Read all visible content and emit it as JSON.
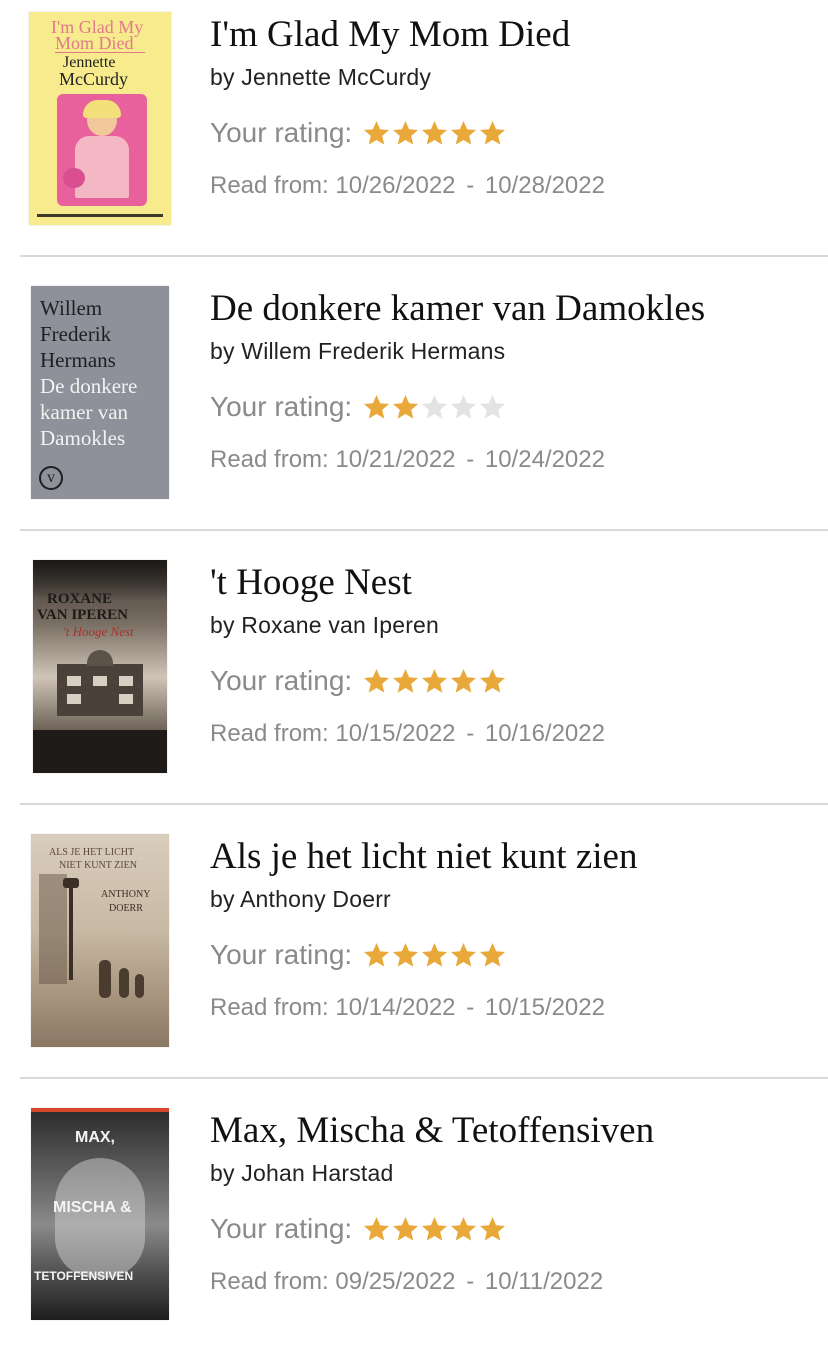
{
  "labels": {
    "rating_prefix": "Your rating:",
    "read_prefix": "Read from:",
    "date_separator": "-"
  },
  "colors": {
    "star_filled": "#e8a93a",
    "star_empty": "#e3e3e3",
    "divider": "#d9d9d9"
  },
  "books": [
    {
      "title": "I'm Glad My Mom Died",
      "author": "by Jennette McCurdy",
      "rating": 5,
      "max_rating": 5,
      "read_start": "10/26/2022",
      "read_end": "10/28/2022",
      "cover": {
        "title_line1": "I'm Glad My",
        "title_line2": "Mom Died",
        "author_line1": "Jennette",
        "author_line2": "McCurdy"
      }
    },
    {
      "title": "De donkere kamer van Damokles",
      "author": "by Willem Frederik Hermans",
      "rating": 2,
      "max_rating": 5,
      "read_start": "10/21/2022",
      "read_end": "10/24/2022",
      "cover": {
        "line1": "Willem",
        "line2": "Frederik",
        "line3": "Hermans",
        "line4": "De donkere",
        "line5": "kamer van",
        "line6": "Damokles",
        "logo": "v"
      }
    },
    {
      "title": "'t Hooge Nest",
      "author": "by Roxane van Iperen",
      "rating": 5,
      "max_rating": 5,
      "read_start": "10/15/2022",
      "read_end": "10/16/2022",
      "cover": {
        "line1": "ROXANE",
        "line2": "VAN IPEREN",
        "line3": "'t Hooge Nest"
      }
    },
    {
      "title": "Als je het licht niet kunt zien",
      "author": "by Anthony Doerr",
      "rating": 5,
      "max_rating": 5,
      "read_start": "10/14/2022",
      "read_end": "10/15/2022",
      "cover": {
        "line1": "ALS JE HET LICHT",
        "line2": "NIET KUNT ZIEN",
        "line3": "ANTHONY",
        "line4": "DOERR"
      }
    },
    {
      "title": "Max, Mischa & Tetoffensiven",
      "author": "by Johan Harstad",
      "rating": 5,
      "max_rating": 5,
      "read_start": "09/25/2022",
      "read_end": "10/11/2022",
      "cover": {
        "line1": "MAX,",
        "line2": "MISCHA &",
        "line3": "TETOFFENSIVEN"
      }
    }
  ]
}
